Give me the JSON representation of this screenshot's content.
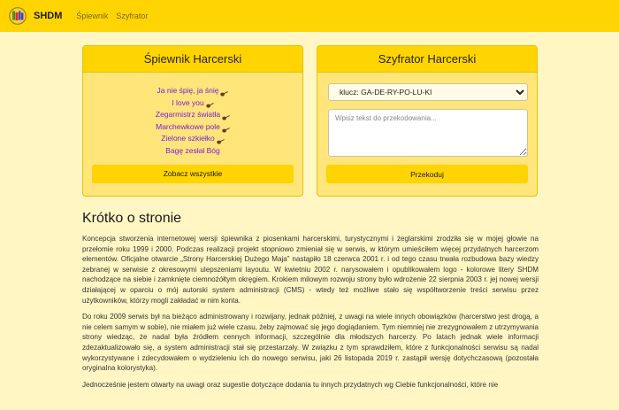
{
  "nav": {
    "brand": "SHDM",
    "links": [
      "Śpiewnik",
      "Szyfrator"
    ]
  },
  "songbook": {
    "title": "Śpiewnik Harcerski",
    "songs": [
      {
        "title": "Ja nie śpię, ja śnię",
        "icon": "guitar-icon"
      },
      {
        "title": "I love you",
        "icon": "guitar-icon"
      },
      {
        "title": "Zegarmistrz światła",
        "icon": "guitar-icon"
      },
      {
        "title": "Marchewkowe pole",
        "icon": "guitar-icon"
      },
      {
        "title": "Zielone szkiełko",
        "icon": "guitar-icon"
      },
      {
        "title": "Bagę zesłał Bóg",
        "icon": ""
      }
    ],
    "button": "Zobacz wszystkie"
  },
  "cipher": {
    "title": "Szyfrator Harcerski",
    "key_selected": "klucz: GA-DE-RY-PO-LU-KI",
    "placeholder": "Wpisz tekst do przekodowania...",
    "button": "Przekoduj"
  },
  "about": {
    "heading": "Krótko o stronie",
    "paragraphs": [
      "Koncepcja stworzenia internetowej wersji śpiewnika z piosenkami harcerskimi, turystycznymi i żeglarskimi zrodziła się w mojej głowie na przełomie roku 1999 i 2000. Podczas realizacji projekt stopniowo zmieniał się w serwis, w którym umieściłem więcej przydatnych harcerzom elementów. Oficjalne otwarcie „Strony Harcerskiej Dużego Maja” nastąpiło 18 czerwca 2001 r. i od tego czasu trwała rozbudowa bazy wiedzy zebranej w serwisie z okresowymi ulepszeniami layoutu. W kwietniu 2002 r. narysowałem i opublikowałem logo - kolorowe litery SHDM nachodzące na siebie i zamknięte ciemnożółtym okręgiem. Krokiem milowym rozwoju strony było wdrożenie 22 sierpnia 2003 r. jej nowej wersji działającej w oparciu o mój autorski system administracji (CMS) - wtedy też możliwe stało się współtworzenie treści serwisu przez użytkowników, którzy mogli zakładać w nim konta.",
      "Do roku 2009 serwis był na bieżąco administrowany i rozwijany, jednak później, z uwagi na wiele innych obowiązków (harcerstwo jest drogą, a nie celem samym w sobie), nie miałem już wiele czasu, żeby zajmować się jego dogiądaniem. Tym niemniej nie zrezygnowałem z utrzymywania strony wiedząc, że nadal była źródłem cennych informacji, szczególnie dla młodszych harcerzy. Po latach jednak wiele informacji zdezaktualizowało się, a system administracji stał się przestarzały. W związku z tym sprawdziłem, które z funkcjonalności serwisu są nadal wykorzystywane i zdecydowałem o wydzieleniu ich do nowego serwisu, jaki 26 listopada 2019 r. zastąpił wersję dotychczasową (pozostała oryginalna kolorystyka).",
      "Jednocześnie jestem otwarty na uwagi oraz sugestie dotyczące dodania tu innych przydatnych wg Ciebie funkcjonalności, które nie"
    ]
  }
}
